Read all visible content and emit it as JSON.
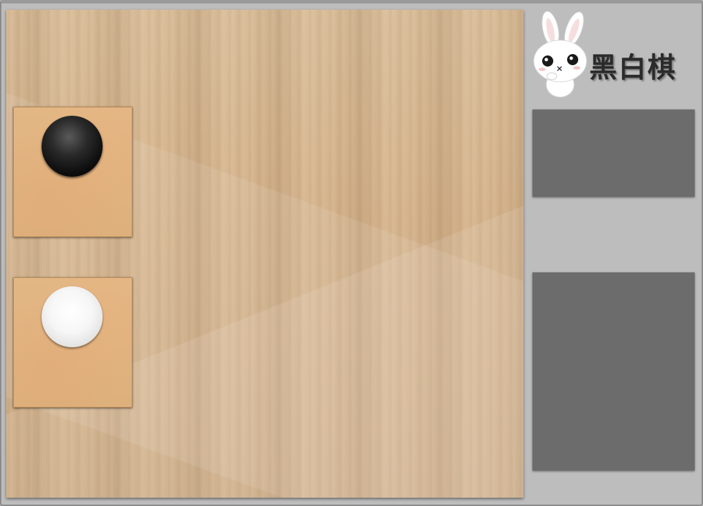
{
  "app": {
    "title": "黑白棋"
  },
  "board": {
    "name": "wooden-board"
  },
  "players": [
    {
      "id": "black",
      "stone_color": "black",
      "card_name": "player-card-black"
    },
    {
      "id": "white",
      "stone_color": "white",
      "card_name": "player-card-white"
    }
  ],
  "logo": {
    "mascot_icon": "rabbit-mascot-icon",
    "title": "黑白棋"
  },
  "panels": {
    "top": {
      "name": "info-panel-top"
    },
    "bottom": {
      "name": "info-panel-bottom"
    }
  },
  "colors": {
    "background": "#bdbdbd",
    "panel": "#6c6c6c",
    "card": "#dfb27f",
    "board": "#d2b28c",
    "title_text": "#2b2b2b"
  }
}
